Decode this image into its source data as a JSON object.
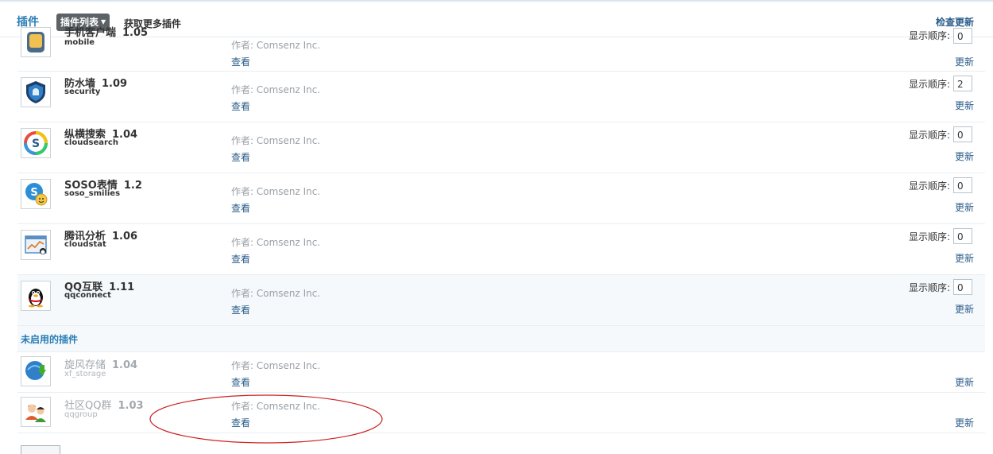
{
  "header": {
    "title": "插件",
    "plugin_list_label": "插件列表",
    "more_plugins_label": "获取更多插件",
    "check_update_label": "检查更新"
  },
  "enabled_plugins": [
    {
      "name": "手机客户端",
      "version": "1.05",
      "identifier": "mobile",
      "author": "作者: Comsenz Inc.",
      "view": "查看",
      "order_label": "显示顺序:",
      "order": "0",
      "update": "更新",
      "icon": "mobile-icon"
    },
    {
      "name": "防水墙",
      "version": "1.09",
      "identifier": "security",
      "author": "作者: Comsenz Inc.",
      "view": "查看",
      "order_label": "显示顺序:",
      "order": "2",
      "update": "更新",
      "icon": "security-shield-icon"
    },
    {
      "name": "纵横搜索",
      "version": "1.04",
      "identifier": "cloudsearch",
      "author": "作者: Comsenz Inc.",
      "view": "查看",
      "order_label": "显示顺序:",
      "order": "0",
      "update": "更新",
      "icon": "cloudsearch-icon"
    },
    {
      "name": "SOSO表情",
      "version": "1.2",
      "identifier": "soso_smilies",
      "author": "作者: Comsenz Inc.",
      "view": "查看",
      "order_label": "显示顺序:",
      "order": "0",
      "update": "更新",
      "icon": "soso-smilies-icon"
    },
    {
      "name": "腾讯分析",
      "version": "1.06",
      "identifier": "cloudstat",
      "author": "作者: Comsenz Inc.",
      "view": "查看",
      "order_label": "显示顺序:",
      "order": "0",
      "update": "更新",
      "icon": "cloudstat-icon"
    },
    {
      "name": "QQ互联",
      "version": "1.11",
      "identifier": "qqconnect",
      "author": "作者: Comsenz Inc.",
      "view": "查看",
      "order_label": "显示顺序:",
      "order": "0",
      "update": "更新",
      "icon": "qq-penguin-icon"
    }
  ],
  "disabled_section_title": "未启用的插件",
  "disabled_plugins": [
    {
      "name": "旋风存储",
      "version": "1.04",
      "identifier": "xf_storage",
      "author": "作者: Comsenz Inc.",
      "view": "查看",
      "update": "更新",
      "icon": "xf-storage-icon"
    },
    {
      "name": "社区QQ群",
      "version": "1.03",
      "identifier": "qqgroup",
      "author": "作者: Comsenz Inc.",
      "view": "查看",
      "update": "更新",
      "icon": "qqgroup-icon"
    }
  ],
  "colors": {
    "accent": "#2a7db4",
    "link": "#2a5c89",
    "annotation": "#cc2222"
  }
}
